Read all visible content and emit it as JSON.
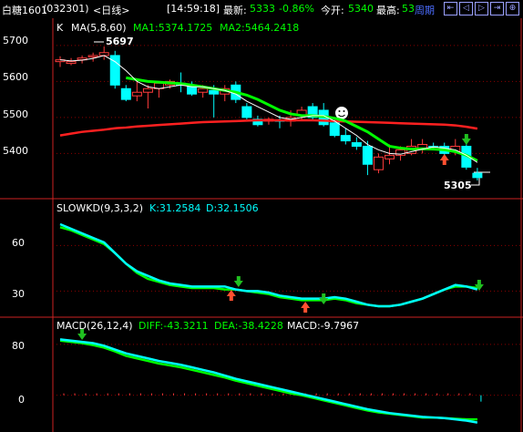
{
  "header": {
    "symbol": "白糖1601",
    "code": "(032301)",
    "period": "<日线>",
    "time": "[14:59:18]",
    "last_label": "最新:",
    "last_value": "5333",
    "change": "-0.86%",
    "open_label": "今开:",
    "open_value": "5340",
    "high_label": "最高:",
    "high_value": "53",
    "period_button": "周期"
  },
  "toolbar": {
    "buttons": [
      {
        "name": "jump-first-icon",
        "glyph": "⇤"
      },
      {
        "name": "prev-icon",
        "glyph": "◁"
      },
      {
        "name": "next-icon",
        "glyph": "▷"
      },
      {
        "name": "jump-last-icon",
        "glyph": "⇥"
      },
      {
        "name": "zoom-in-icon",
        "glyph": "⊕"
      }
    ]
  },
  "colors": {
    "background": "#000000",
    "up": "#ff3c3c",
    "down": "#00ffff",
    "ma5": "#ffffff",
    "ma1": "#00ff00",
    "ma2": "#ff2020",
    "kd_k": "#00ffff",
    "kd_d": "#00ff00",
    "grid": "#8b0000",
    "axis": "#cc2222"
  },
  "main_panel": {
    "indicator_k": "K",
    "ma_title": "MA(5,8,60)",
    "ma1_text": "MA1:5374.1725",
    "ma2_text": "MA2:5464.2418",
    "yticks": [
      "5700",
      "5600",
      "5500",
      "5400"
    ],
    "high_note": "5697",
    "low_note": "5305"
  },
  "kd_panel": {
    "title": "SLOWKD(9,3,3,2)",
    "k_text": "K:31.2584",
    "d_text": "D:32.1506",
    "yticks": [
      "60",
      "30"
    ]
  },
  "macd_panel": {
    "title": "MACD(26,12,4)",
    "diff_text": "DIFF:-43.3211",
    "dea_text": "DEA:-38.4228",
    "macd_text": "MACD:-9.7967",
    "yticks": [
      "80",
      "0"
    ]
  },
  "chart_data": {
    "type": "candlestick",
    "price_ylim": [
      5320,
      5730
    ],
    "candles": [
      {
        "o": 5655,
        "h": 5670,
        "l": 5640,
        "c": 5660
      },
      {
        "o": 5650,
        "h": 5665,
        "l": 5645,
        "c": 5655
      },
      {
        "o": 5660,
        "h": 5672,
        "l": 5650,
        "c": 5665
      },
      {
        "o": 5668,
        "h": 5680,
        "l": 5655,
        "c": 5672
      },
      {
        "o": 5672,
        "h": 5697,
        "l": 5660,
        "c": 5680
      },
      {
        "o": 5672,
        "h": 5685,
        "l": 5580,
        "c": 5590
      },
      {
        "o": 5580,
        "h": 5590,
        "l": 5545,
        "c": 5550
      },
      {
        "o": 5560,
        "h": 5605,
        "l": 5545,
        "c": 5570
      },
      {
        "o": 5570,
        "h": 5590,
        "l": 5525,
        "c": 5580
      },
      {
        "o": 5580,
        "h": 5600,
        "l": 5555,
        "c": 5595
      },
      {
        "o": 5590,
        "h": 5605,
        "l": 5580,
        "c": 5600
      },
      {
        "o": 5595,
        "h": 5625,
        "l": 5570,
        "c": 5590
      },
      {
        "o": 5590,
        "h": 5600,
        "l": 5560,
        "c": 5565
      },
      {
        "o": 5570,
        "h": 5590,
        "l": 5555,
        "c": 5580
      },
      {
        "o": 5575,
        "h": 5590,
        "l": 5500,
        "c": 5565
      },
      {
        "o": 5565,
        "h": 5590,
        "l": 5545,
        "c": 5580
      },
      {
        "o": 5590,
        "h": 5600,
        "l": 5540,
        "c": 5550
      },
      {
        "o": 5530,
        "h": 5540,
        "l": 5495,
        "c": 5500
      },
      {
        "o": 5495,
        "h": 5505,
        "l": 5475,
        "c": 5480
      },
      {
        "o": 5490,
        "h": 5500,
        "l": 5480,
        "c": 5495
      },
      {
        "o": 5492,
        "h": 5505,
        "l": 5470,
        "c": 5490
      },
      {
        "o": 5490,
        "h": 5520,
        "l": 5475,
        "c": 5500
      },
      {
        "o": 5505,
        "h": 5530,
        "l": 5490,
        "c": 5520
      },
      {
        "o": 5530,
        "h": 5540,
        "l": 5490,
        "c": 5500
      },
      {
        "o": 5520,
        "h": 5540,
        "l": 5475,
        "c": 5480
      },
      {
        "o": 5485,
        "h": 5495,
        "l": 5445,
        "c": 5450
      },
      {
        "o": 5450,
        "h": 5470,
        "l": 5425,
        "c": 5435
      },
      {
        "o": 5430,
        "h": 5445,
        "l": 5410,
        "c": 5420
      },
      {
        "o": 5420,
        "h": 5435,
        "l": 5340,
        "c": 5370
      },
      {
        "o": 5355,
        "h": 5400,
        "l": 5345,
        "c": 5390
      },
      {
        "o": 5385,
        "h": 5425,
        "l": 5370,
        "c": 5395
      },
      {
        "o": 5395,
        "h": 5420,
        "l": 5380,
        "c": 5410
      },
      {
        "o": 5400,
        "h": 5440,
        "l": 5395,
        "c": 5420
      },
      {
        "o": 5415,
        "h": 5440,
        "l": 5400,
        "c": 5425
      },
      {
        "o": 5420,
        "h": 5430,
        "l": 5410,
        "c": 5418
      },
      {
        "o": 5420,
        "h": 5430,
        "l": 5385,
        "c": 5400
      },
      {
        "o": 5405,
        "h": 5440,
        "l": 5395,
        "c": 5420
      },
      {
        "o": 5420,
        "h": 5430,
        "l": 5355,
        "c": 5362
      },
      {
        "o": 5345,
        "h": 5360,
        "l": 5325,
        "c": 5333
      }
    ],
    "ma5": [
      5660,
      5657,
      5659,
      5664,
      5672,
      5655,
      5630,
      5600,
      5585,
      5580,
      5585,
      5590,
      5585,
      5585,
      5580,
      5575,
      5565,
      5545,
      5530,
      5515,
      5500,
      5495,
      5500,
      5505,
      5505,
      5490,
      5470,
      5450,
      5425,
      5410,
      5400,
      5398,
      5405,
      5412,
      5418,
      5415,
      5410,
      5395,
      5375
    ],
    "ma_mid": [
      null,
      null,
      null,
      null,
      null,
      null,
      5610,
      5605,
      5600,
      5598,
      5596,
      5594,
      5590,
      5585,
      5580,
      5575,
      5570,
      5562,
      5550,
      5535,
      5520,
      5510,
      5505,
      5505,
      5503,
      5498,
      5490,
      5475,
      5460,
      5440,
      5420,
      5415,
      5412,
      5413,
      5412,
      5410,
      5405,
      5395,
      5380
    ],
    "ma60": [
      5450,
      5455,
      5460,
      5463,
      5466,
      5470,
      5472,
      5475,
      5477,
      5479,
      5481,
      5483,
      5485,
      5487,
      5488,
      5489,
      5490,
      5491,
      5492,
      5492,
      5492,
      5492,
      5492,
      5492,
      5491,
      5490,
      5489,
      5488,
      5487,
      5486,
      5485,
      5484,
      5483,
      5482,
      5481,
      5480,
      5478,
      5474,
      5469
    ],
    "kd_k": [
      74,
      71,
      68,
      65,
      62,
      55,
      48,
      43,
      40,
      37,
      35,
      34,
      33,
      33,
      33,
      33,
      31,
      30,
      30,
      29,
      27,
      26,
      25,
      25,
      25,
      26,
      25,
      23,
      21,
      20,
      20,
      21,
      23,
      25,
      28,
      31,
      34,
      33,
      31
    ],
    "kd_d": [
      72,
      70,
      67,
      64,
      61,
      55,
      48,
      42,
      38,
      36,
      34,
      33,
      32,
      32,
      32,
      31,
      31,
      30,
      29,
      28,
      26,
      25,
      24,
      24,
      24,
      25,
      24,
      22,
      21,
      20,
      20,
      21,
      23,
      25,
      28,
      31,
      33,
      33,
      32
    ],
    "kd_ylim": [
      14,
      80
    ],
    "diff": [
      88,
      86,
      84,
      82,
      78,
      72,
      66,
      62,
      58,
      54,
      51,
      48,
      44,
      40,
      36,
      31,
      26,
      22,
      18,
      14,
      10,
      6,
      2,
      -2,
      -6,
      -10,
      -14,
      -18,
      -22,
      -25,
      -28,
      -30,
      -32,
      -34,
      -35,
      -36,
      -38,
      -40,
      -43
    ],
    "dea": [
      86,
      84,
      82,
      79,
      75,
      69,
      62,
      58,
      54,
      50,
      47,
      44,
      40,
      36,
      32,
      28,
      23,
      19,
      15,
      11,
      7,
      3,
      0,
      -4,
      -8,
      -12,
      -16,
      -20,
      -24,
      -27,
      -29,
      -31,
      -33,
      -35,
      -35,
      -36,
      -37,
      -38,
      -38
    ],
    "macd": [
      3,
      3,
      3,
      3,
      3,
      3,
      3,
      3,
      3,
      3,
      3,
      3,
      3,
      3,
      3,
      3,
      3,
      3,
      3,
      3,
      3,
      3,
      3,
      3,
      3,
      3,
      3,
      3,
      3,
      3,
      3,
      3,
      3,
      3,
      3,
      3,
      3,
      3,
      -10
    ],
    "macd_ylim": [
      -55,
      100
    ]
  }
}
